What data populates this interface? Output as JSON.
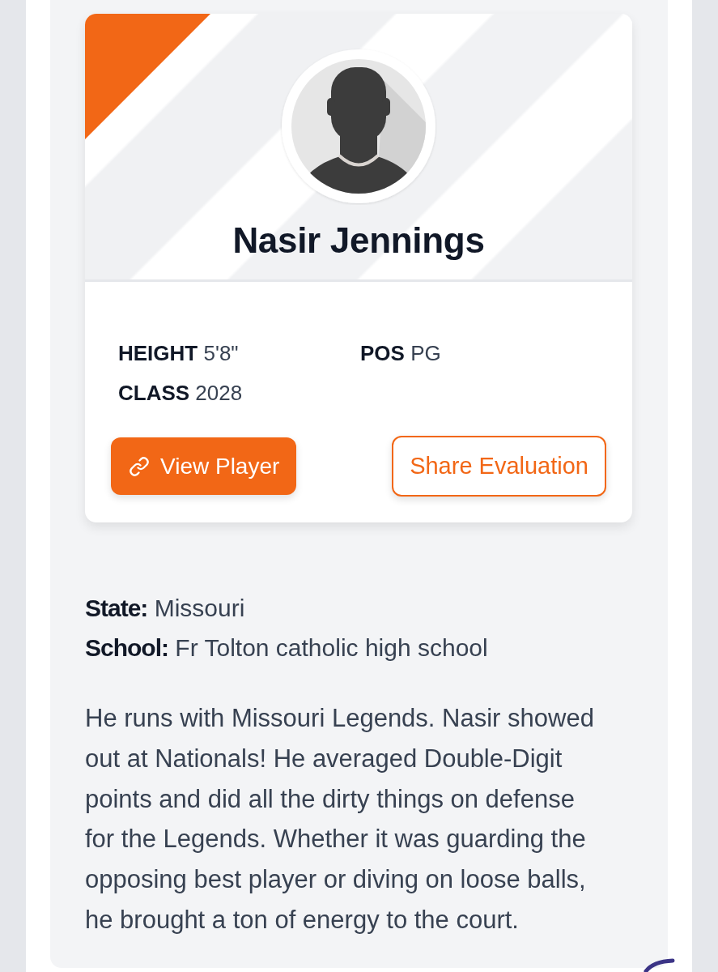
{
  "player": {
    "name": "Nasir Jennings",
    "stats": [
      {
        "label": "HEIGHT",
        "value": "5'8\""
      },
      {
        "label": "POS",
        "value": "PG"
      },
      {
        "label": "CLASS",
        "value": "2028"
      }
    ],
    "buttons": [
      {
        "label": "View Player",
        "kind": "primary"
      },
      {
        "label": "Share Evaluation",
        "kind": "outline"
      }
    ]
  },
  "details": [
    {
      "label": "State:",
      "value": "Missouri"
    },
    {
      "label": "School:",
      "value": "Fr Tolton catholic high school"
    }
  ],
  "bio": "He runs with Missouri Legends. Nasir showed out at Nationals! He averaged Double-Digit points and did all the dirty things on defense for the Legends. Whether it was guarding the opposing best player or diving on loose balls, he brought a ton of energy to the court."
}
